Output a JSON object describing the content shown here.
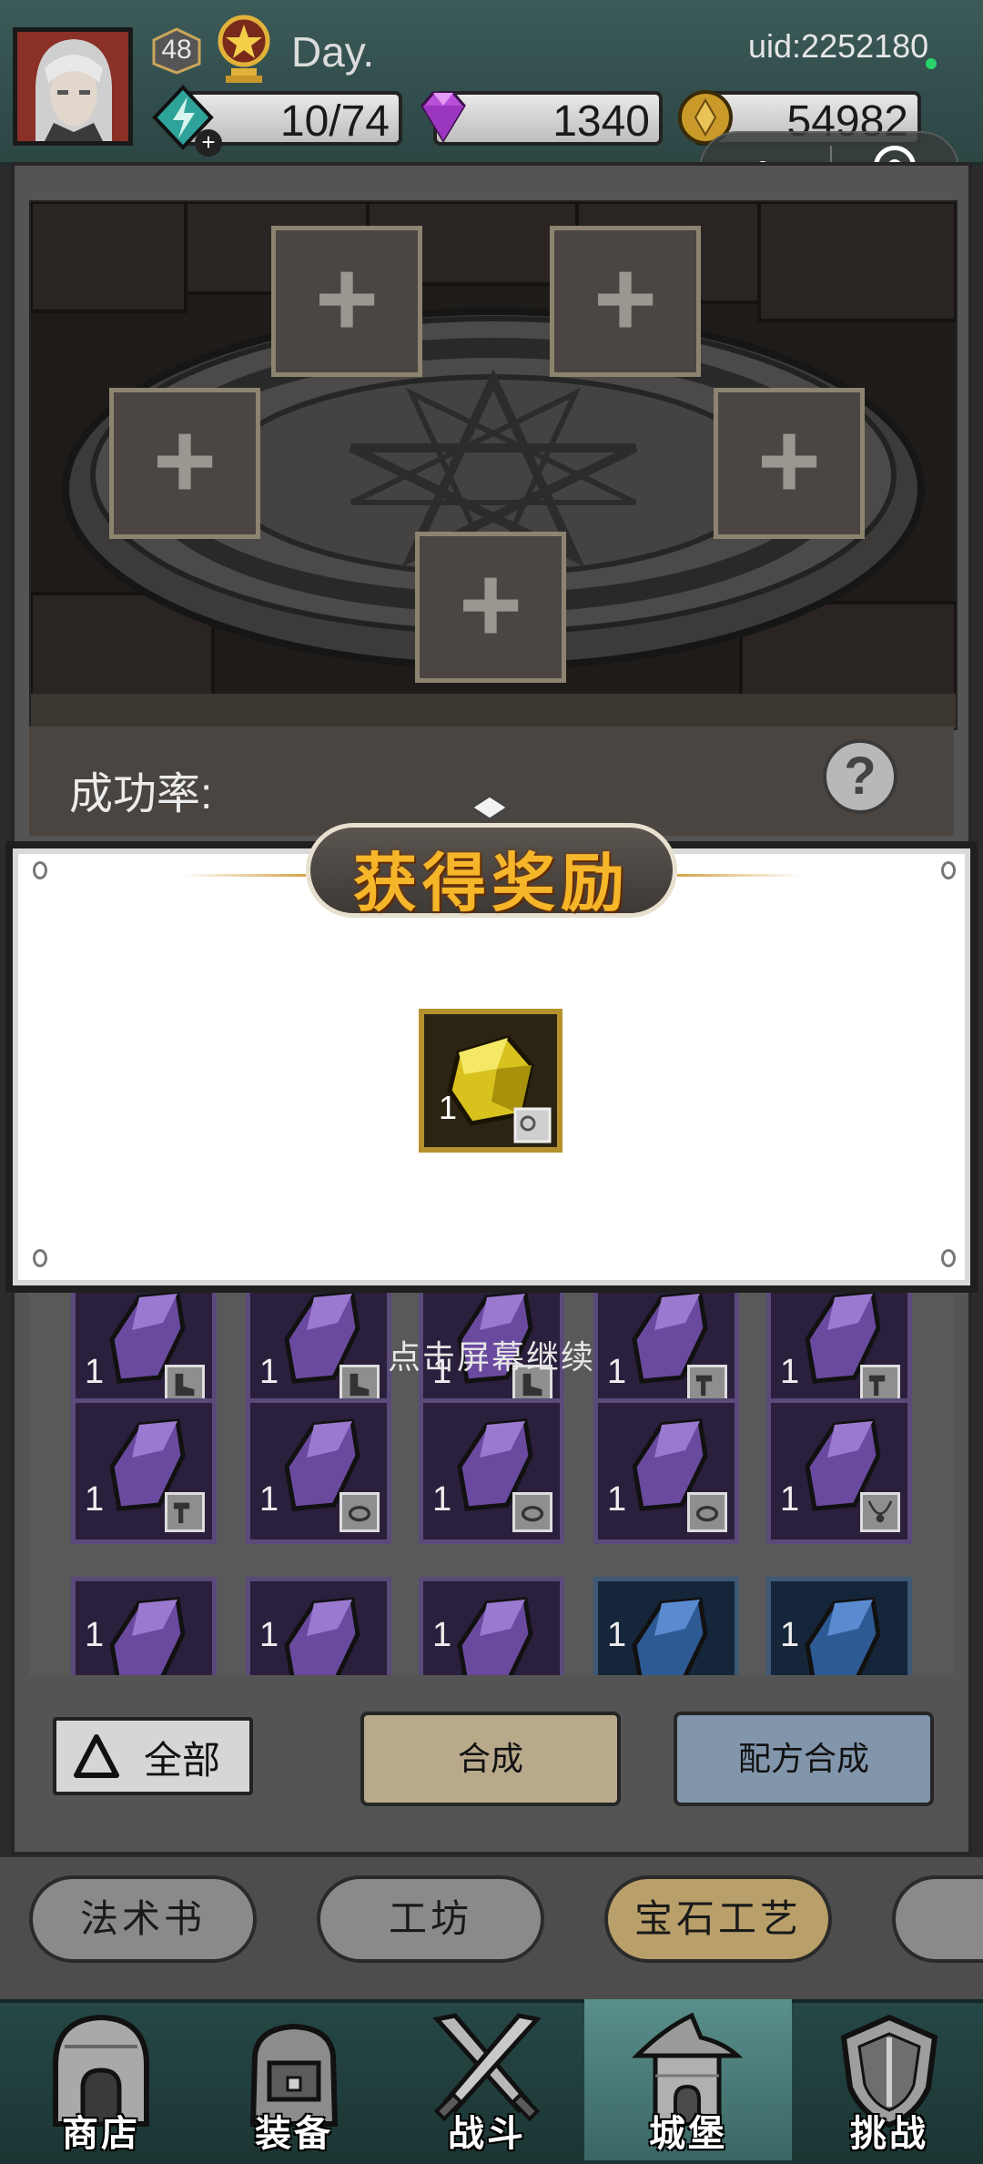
{
  "header": {
    "level": "48",
    "player_name": "Day.",
    "uid": "uid:2252180",
    "energy": "10/74",
    "gems": "1340",
    "gold": "54982",
    "energy_plus": "+"
  },
  "altar": {
    "slot_symbol": "+",
    "success_rate_label": "成功率:",
    "help_symbol": "?"
  },
  "modal": {
    "title": "获得奖励",
    "reward": {
      "item": "yellow-gem",
      "count": "1"
    },
    "continue_hint": "点击屏幕继续"
  },
  "inventory": {
    "rows": [
      [
        {
          "color": "purple",
          "count": "1",
          "tag": "boot-icon"
        },
        {
          "color": "purple",
          "count": "1",
          "tag": "boot-icon"
        },
        {
          "color": "purple",
          "count": "1",
          "tag": "boot-icon"
        },
        {
          "color": "purple",
          "count": "1",
          "tag": "hammer-icon"
        },
        {
          "color": "purple",
          "count": "1",
          "tag": "hammer-icon"
        }
      ],
      [
        {
          "color": "purple",
          "count": "1",
          "tag": "hammer-icon"
        },
        {
          "color": "purple",
          "count": "1",
          "tag": "ring-icon"
        },
        {
          "color": "purple",
          "count": "1",
          "tag": "ring-icon"
        },
        {
          "color": "purple",
          "count": "1",
          "tag": "ring-icon"
        },
        {
          "color": "purple",
          "count": "1",
          "tag": "necklace-icon"
        }
      ],
      [
        {
          "color": "purple",
          "count": "1"
        },
        {
          "color": "purple",
          "count": "1"
        },
        {
          "color": "purple",
          "count": "1"
        },
        {
          "color": "blue",
          "count": "1"
        },
        {
          "color": "blue",
          "count": "1"
        }
      ]
    ]
  },
  "controls": {
    "filter_label": "全部",
    "synthesize_label": "合成",
    "recipe_synthesize_label": "配方合成"
  },
  "tabs": [
    {
      "label": "法术书",
      "active": false
    },
    {
      "label": "工坊",
      "active": false
    },
    {
      "label": "宝石工艺",
      "active": true
    },
    {
      "label": "",
      "active": false
    }
  ],
  "nav": [
    {
      "label": "商店",
      "icon": "shop-icon",
      "active": false
    },
    {
      "label": "装备",
      "icon": "backpack-icon",
      "active": false
    },
    {
      "label": "战斗",
      "icon": "crossed-swords-icon",
      "active": false
    },
    {
      "label": "城堡",
      "icon": "castle-icon",
      "active": true
    },
    {
      "label": "挑战",
      "icon": "shield-icon",
      "active": false
    }
  ],
  "colors": {
    "topbar": "#3b5a58",
    "gold_title": "#f6b62a",
    "active_tab": "#b9a06a",
    "purple_gem": "#6a4a9e",
    "blue_gem": "#2e5a94",
    "yellow_gem": "#d8c21e"
  }
}
